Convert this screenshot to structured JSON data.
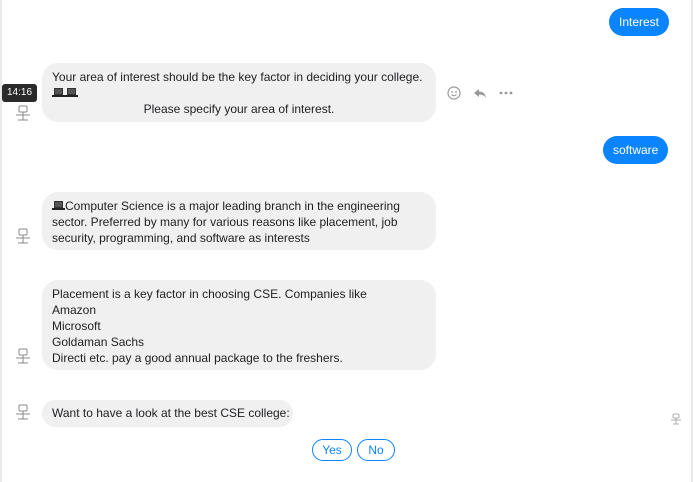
{
  "messages": {
    "user1": "Interest",
    "bot1": {
      "line1": "Your area of interest should be the key factor in deciding your college.",
      "line2": "Please specify your area of interest."
    },
    "user2": "software",
    "bot2": {
      "line1": "Computer Science is a major leading branch in the engineering",
      "line2": "sector. Preferred by many for various reasons like placement, job",
      "line3": "security, programming, and software as interests"
    },
    "bot3": {
      "line1": "Placement is a key factor in choosing CSE. Companies like",
      "line2": "Amazon",
      "line3": "Microsoft",
      "line4": "Goldaman Sachs",
      "line5": "Directi etc. pay a good annual package to the freshers."
    },
    "bot4": "Want to have a look at the best CSE college:"
  },
  "timestamp": "14:16",
  "quick_replies": {
    "yes": "Yes",
    "no": "No"
  },
  "icons": {
    "avatar": "robot-avatar-icon",
    "emoji": "smiley-icon",
    "reply": "reply-icon",
    "more": "more-options-icon",
    "laptop": "laptop-icon"
  },
  "colors": {
    "accent": "#0a84ff",
    "bubble": "#f1f0f0"
  }
}
